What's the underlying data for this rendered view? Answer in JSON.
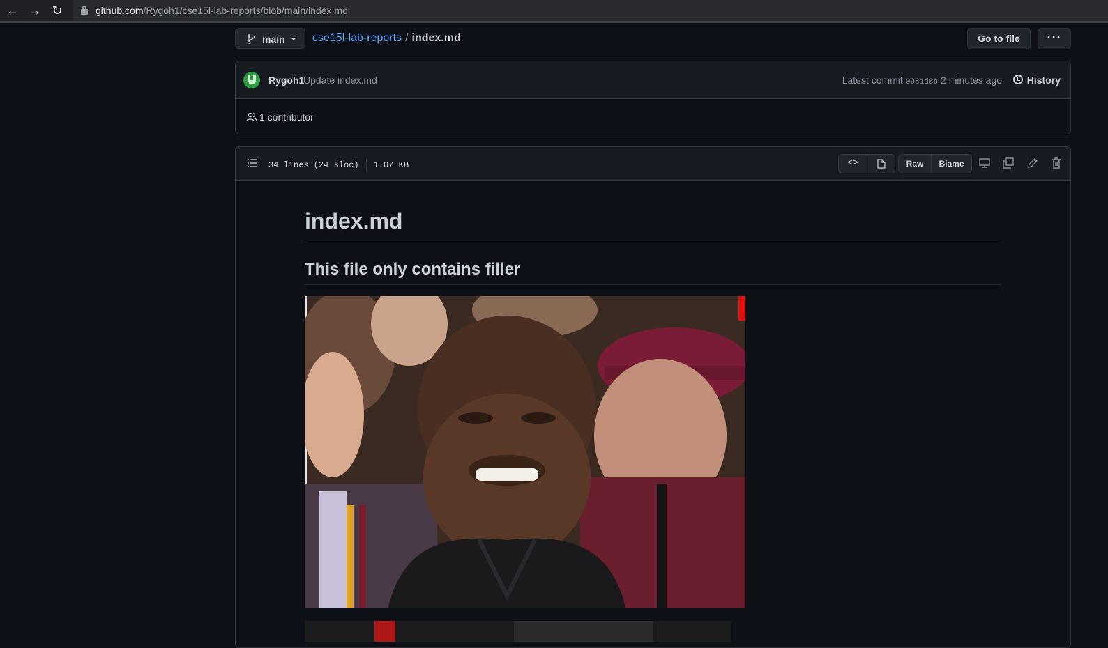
{
  "browser": {
    "url_host": "github.com",
    "url_path": "/Rygoh1/cse15l-lab-reports/blob/main/index.md"
  },
  "repo_nav": {
    "branch": "main",
    "repo_name": "cse15l-lab-reports",
    "separator": "/",
    "file_name": "index.md",
    "go_to_file": "Go to file",
    "more": "···"
  },
  "commit": {
    "author": "Rygoh1",
    "message": "Update index.md",
    "latest_label": "Latest commit",
    "sha": "0981d8b",
    "time": "2 minutes ago",
    "history": "History",
    "contributors": "1 contributor"
  },
  "file": {
    "lines": "34 lines (24 sloc)",
    "size": "1.07 KB",
    "code_label": "<>",
    "raw": "Raw",
    "blame": "Blame"
  },
  "markdown": {
    "h1": "index.md",
    "h2": "This file only contains filler"
  },
  "colors": {
    "background": "#0d1117",
    "link": "#58a6ff",
    "border": "#30363d"
  }
}
